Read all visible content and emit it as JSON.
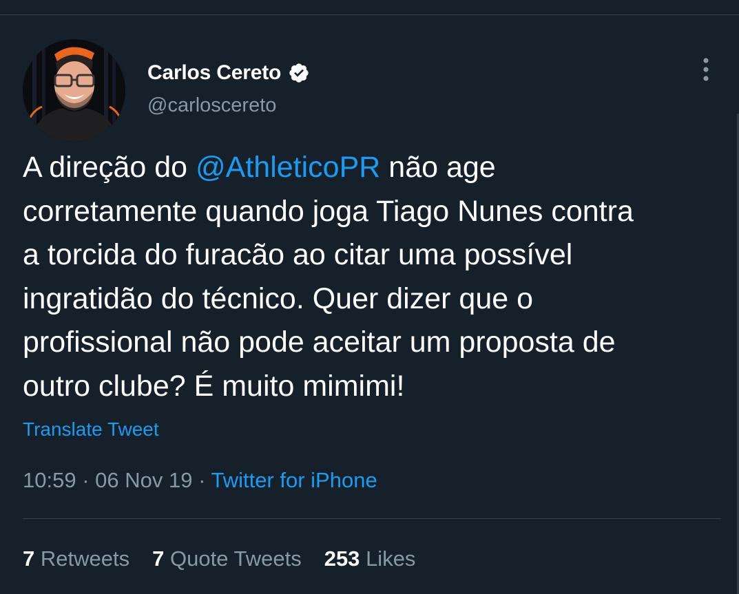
{
  "colors": {
    "background": "#15202b",
    "text_primary": "#ffffff",
    "text_secondary": "#8899a6",
    "accent": "#1d9bf0",
    "divider": "#38444d"
  },
  "author": {
    "display_name": "Carlos Cereto",
    "handle": "@carloscereto",
    "verified": true,
    "verified_icon": "verified-badge-icon",
    "avatar_icon": "profile-photo"
  },
  "menu": {
    "icon": "more-vertical-icon"
  },
  "tweet": {
    "text_before_mention": "A direção do ",
    "mention": "@AthleticoPR",
    "text_after_mention": " não age\ncorretamente quando joga Tiago Nunes contra\na torcida do furacão ao citar uma possível\ningratidão do técnico. Quer dizer que o\nprofissional não pode aceitar um proposta de\noutro clube? É muito mimimi!"
  },
  "translate_label": "Translate Tweet",
  "meta": {
    "time": "10:59",
    "separator": " · ",
    "date": "06 Nov 19",
    "source": "Twitter for iPhone"
  },
  "stats": {
    "retweets_count": "7",
    "retweets_label": "Retweets",
    "quotes_count": "7",
    "quotes_label": "Quote Tweets",
    "likes_count": "253",
    "likes_label": "Likes"
  }
}
